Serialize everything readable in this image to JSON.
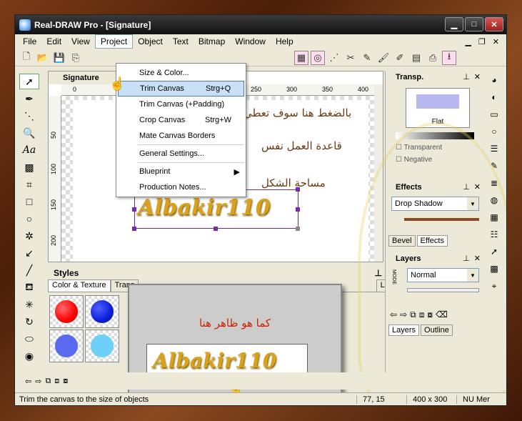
{
  "window": {
    "title": "Real-DRAW Pro - [Signature]",
    "controls": [
      "minimize",
      "maximize",
      "close"
    ]
  },
  "menubar": {
    "items": [
      "File",
      "Edit",
      "View",
      "Project",
      "Object",
      "Text",
      "Bitmap",
      "Window",
      "Help"
    ],
    "active": "Project"
  },
  "project_menu": {
    "items": [
      {
        "label": "Size & Color...",
        "shortcut": ""
      },
      {
        "label": "Trim Canvas",
        "shortcut": "Strg+Q",
        "highlighted": true
      },
      {
        "label": "Trim Canvas (+Padding)",
        "shortcut": ""
      },
      {
        "label": "Crop Canvas",
        "shortcut": "Strg+W"
      },
      {
        "label": "Mate Canvas Borders",
        "shortcut": ""
      },
      {
        "label": "General Settings...",
        "shortcut": ""
      },
      {
        "label": "Blueprint",
        "shortcut": "",
        "submenu": true
      },
      {
        "label": "Production Notes...",
        "shortcut": ""
      }
    ]
  },
  "document": {
    "tab_title": "Signature",
    "ruler_h": [
      "0",
      "250",
      "300",
      "350",
      "400"
    ],
    "ruler_v": [
      "50",
      "100",
      "150",
      "200"
    ],
    "signature_text": "Albakir110",
    "annotation_lines": [
      "بالضغط هنا سوف تعطي",
      "قاعدة العمل نفس",
      "مساحة الشكل"
    ]
  },
  "styles_panel": {
    "title": "Styles",
    "tabs": [
      "Color & Texture",
      "Trans",
      "Libr"
    ],
    "swatch_colors": [
      "#ff0000",
      "#0a1ed8",
      "#5a6af0",
      "#6cd0f8"
    ]
  },
  "popup": {
    "caption": "كما هو ظاهر هنا",
    "signature_text": "Albakir110"
  },
  "transp_panel": {
    "title": "Transp.",
    "mode": "Flat",
    "options": [
      "Transparent",
      "Negative"
    ]
  },
  "effects_panel": {
    "title": "Effects",
    "effect": "Drop Shadow",
    "tabs": [
      "Bevel",
      "Effects"
    ]
  },
  "layers_panel": {
    "title": "Layers",
    "mode_label": "MODE",
    "mode": "Normal",
    "tabs": [
      "Layers",
      "Outline"
    ]
  },
  "status": {
    "message": "Trim the canvas to the size of objects",
    "coords": "77, 15",
    "size": "400 x 300",
    "indicator": "NU Mer"
  },
  "colors": {
    "accent": "#c9e0f7",
    "signature_gold": "#d9a21a",
    "selection": "#7a2ab0",
    "arabic_text": "#6b3a10",
    "popup_caption": "#cc2200"
  }
}
